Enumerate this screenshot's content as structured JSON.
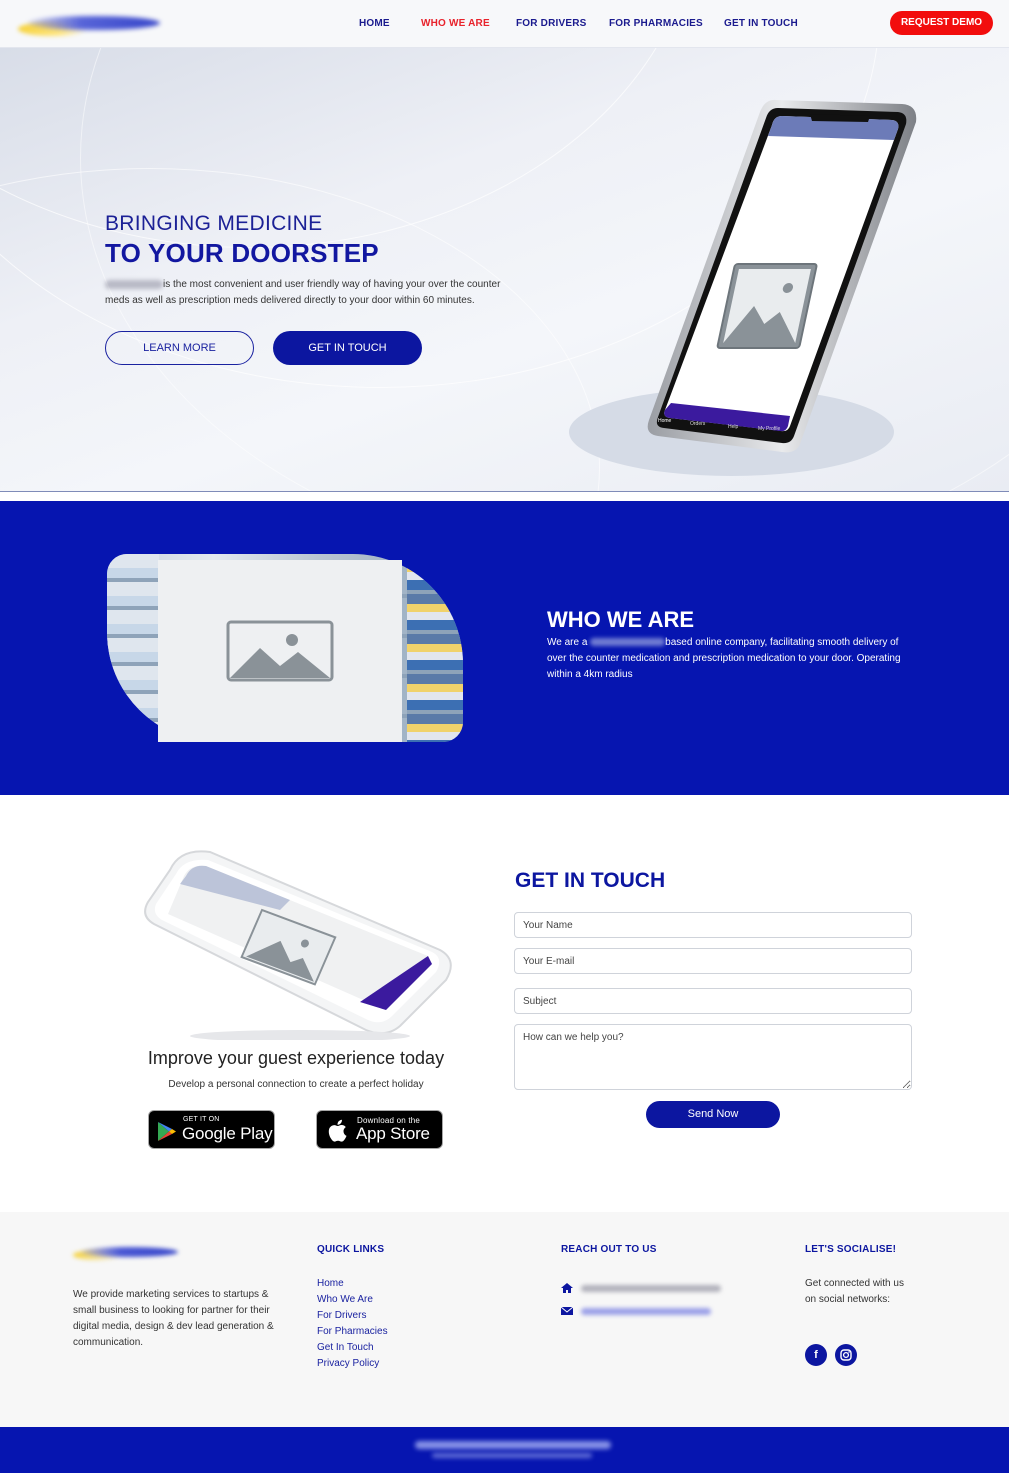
{
  "nav": {
    "items": [
      {
        "label": "HOME"
      },
      {
        "label": "WHO WE ARE"
      },
      {
        "label": "FOR DRIVERS"
      },
      {
        "label": "FOR PHARMACIES"
      },
      {
        "label": "GET IN TOUCH"
      }
    ],
    "active_item": "WHO WE ARE",
    "demo_button": "REQUEST DEMO"
  },
  "hero": {
    "kicker": "BRINGING MEDICINE",
    "headline": "TO YOUR DOORSTEP",
    "description": "is the most convenient and user friendly way of having your over the counter meds as well as prescription meds delivered directly to your door within 60 minutes.",
    "learn_more": "LEARN MORE",
    "get_in_touch": "GET IN TOUCH",
    "phone_tabs": [
      "Home",
      "Orders",
      "Help",
      "My Profile"
    ]
  },
  "who": {
    "title": "WHO WE ARE",
    "text_prefix": "We are a",
    "text_rest": "based online company, facilitating smooth delivery of over the counter medication and prescription medication to your door. Operating within a 4km radius"
  },
  "promo": {
    "title": "Improve your guest experience today",
    "subtitle": "Develop a personal connection to create a perfect holiday",
    "google": {
      "small": "GET IT ON",
      "big": "Google Play"
    },
    "apple": {
      "small": "Download on the",
      "big": "App Store"
    }
  },
  "contact": {
    "title": "GET IN TOUCH",
    "name_placeholder": "Your Name",
    "email_placeholder": "Your E-mail",
    "subject_placeholder": "Subject",
    "message_placeholder": "How can we help you?",
    "send": "Send Now"
  },
  "footer": {
    "about": "We provide marketing services to startups & small business to looking for partner for their digital media, design & dev lead generation & communication.",
    "quick_links_title": "QUICK LINKS",
    "quick_links": [
      "Home",
      "Who We Are",
      "For Drivers",
      "For Pharmacies",
      "Get In Touch",
      "Privacy Policy"
    ],
    "reach_title": "REACH OUT TO US",
    "social_title": "LET'S SOCIALISE!",
    "social_text": "Get connected with us on social networks:",
    "icons": [
      "home-icon",
      "envelope-icon",
      "facebook-icon",
      "instagram-icon"
    ]
  },
  "colors": {
    "brand_blue": "#0c16a0",
    "section_blue": "#0615b0",
    "accent_red": "#f20d0d"
  }
}
